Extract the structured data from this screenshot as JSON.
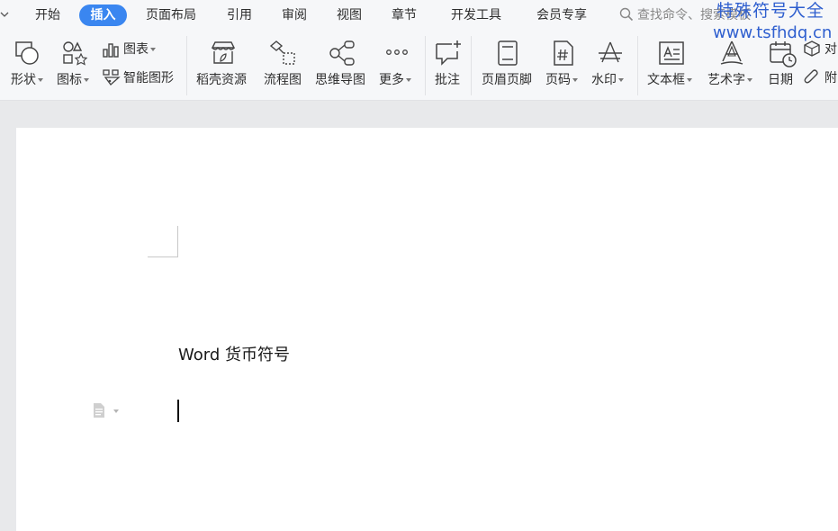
{
  "tabs": [
    {
      "label": "开始",
      "active": false
    },
    {
      "label": "插入",
      "active": true
    },
    {
      "label": "页面布局",
      "active": false
    },
    {
      "label": "引用",
      "active": false
    },
    {
      "label": "审阅",
      "active": false
    },
    {
      "label": "视图",
      "active": false
    },
    {
      "label": "章节",
      "active": false
    },
    {
      "label": "开发工具",
      "active": false
    },
    {
      "label": "会员专享",
      "active": false
    }
  ],
  "search": {
    "placeholder": "查找命令、搜索模板"
  },
  "watermark": {
    "title": "特殊符号大全",
    "url": "www.tsfhdq.cn"
  },
  "ribbon": {
    "shape": "形状",
    "icon": "图标",
    "chart": "图表",
    "smart_graphic": "智能图形",
    "resources": "稻壳资源",
    "flowchart": "流程图",
    "mindmap": "思维导图",
    "more": "更多",
    "comment": "批注",
    "header_footer": "页眉页脚",
    "page_number": "页码",
    "watermark": "水印",
    "textbox": "文本框",
    "wordart": "艺术字",
    "date": "日期",
    "object": "对",
    "attachment": "附"
  },
  "document": {
    "text": "Word 货币符号"
  },
  "colors": {
    "accent": "#3a86f0",
    "watermark": "#2f5fcf",
    "page": "#ffffff",
    "canvas": "#e8e9eb"
  }
}
